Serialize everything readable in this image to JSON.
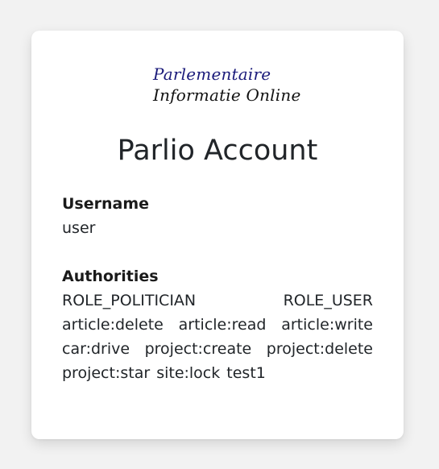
{
  "logo": {
    "line1": "Parlementaire",
    "line2": "Informatie Online"
  },
  "account": {
    "title": "Parlio Account",
    "username_label": "Username",
    "username_value": "user",
    "authorities_label": "Authorities",
    "authorities_value": "ROLE_POLITICIAN ROLE_USER article:delete article:read article:write car:drive project:create project:delete project:star site:lock test1"
  },
  "colors": {
    "background": "#f2f2f2",
    "card": "#ffffff",
    "logo_accent": "#1a1a7a",
    "text": "#212529"
  }
}
